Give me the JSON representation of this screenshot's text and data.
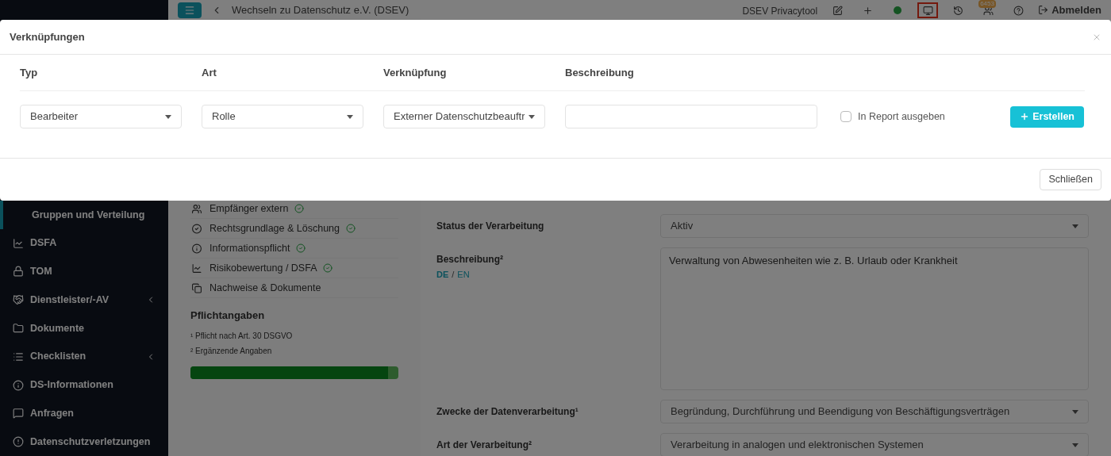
{
  "topbar": {
    "title": "Wechseln zu Datenschutz e.V. (DSEV)",
    "app_name": "DSEV Privacytool",
    "icons": [
      {
        "kind": "edit",
        "highlighted": false
      },
      {
        "kind": "plus",
        "highlighted": false
      },
      {
        "kind": "dot",
        "highlighted": false
      },
      {
        "kind": "monitor",
        "highlighted": true
      },
      {
        "kind": "history",
        "highlighted": false
      },
      {
        "kind": "users",
        "highlighted": false,
        "badge": "6453"
      },
      {
        "kind": "help",
        "highlighted": false
      }
    ],
    "logout": "Abmelden"
  },
  "sidebar": {
    "items": [
      {
        "label": "Gruppen und Verteilung",
        "submenu": false,
        "selected": true
      },
      {
        "label": "DSFA",
        "submenu": false,
        "selected": false
      },
      {
        "label": "TOM",
        "submenu": false,
        "selected": false
      },
      {
        "label": "Dienstleister/-AV",
        "submenu": true,
        "selected": false
      },
      {
        "label": "Dokumente",
        "submenu": false,
        "selected": false
      },
      {
        "label": "Checklisten",
        "submenu": true,
        "selected": false
      },
      {
        "label": "DS-Informationen",
        "submenu": false,
        "selected": false
      },
      {
        "label": "Anfragen",
        "submenu": false,
        "selected": false
      },
      {
        "label": "Datenschutzverletzungen",
        "submenu": false,
        "selected": false
      }
    ]
  },
  "sections": {
    "items": [
      {
        "label": "Empfänger extern",
        "complete": true
      },
      {
        "label": "Rechtsgrundlage & Löschung",
        "complete": true
      },
      {
        "label": "Informationspflicht",
        "complete": true
      },
      {
        "label": "Risikobewertung / DSFA",
        "complete": true
      },
      {
        "label": "Nachweise & Dokumente",
        "complete": false
      }
    ],
    "heading": "Pflichtangaben",
    "notes": [
      "¹ Pflicht nach Art. 30 DSGVO",
      "² Ergänzende Angaben"
    ],
    "level": 0.95
  },
  "form": {
    "fields": [
      {
        "label": "Status der Verarbeitung",
        "kind": "select",
        "value": "Aktiv"
      },
      {
        "label": "Beschreibung²",
        "kind": "textarea",
        "value": "Verwaltung von Abwesenheiten wie z. B. Urlaub oder Krankheit",
        "languages": [
          {
            "label": "DE",
            "selected": true
          },
          {
            "label": "EN",
            "selected": false
          }
        ],
        "language_separator": "/"
      },
      {
        "label": "Zwecke der Datenverarbeitung¹",
        "kind": "select",
        "value": "Begründung, Durchführung und Beendigung von Beschäftigungsverträgen"
      },
      {
        "label": "Art der Verarbeitung²",
        "kind": "select",
        "value": "Verarbeitung in analogen und elektronischen Systemen"
      }
    ]
  },
  "modal": {
    "title": "Verknüpfungen",
    "columns": [
      "Typ",
      "Art",
      "Verknüpfung",
      "Beschreibung"
    ],
    "typ": "Bearbeiter",
    "art": "Rolle",
    "verknuepfung": "Externer Datenschutzbeauftr",
    "checkbox": {
      "label": "In Report ausgeben",
      "checked": false
    },
    "create_button": "Erstellen",
    "close_button": "Schließen"
  }
}
